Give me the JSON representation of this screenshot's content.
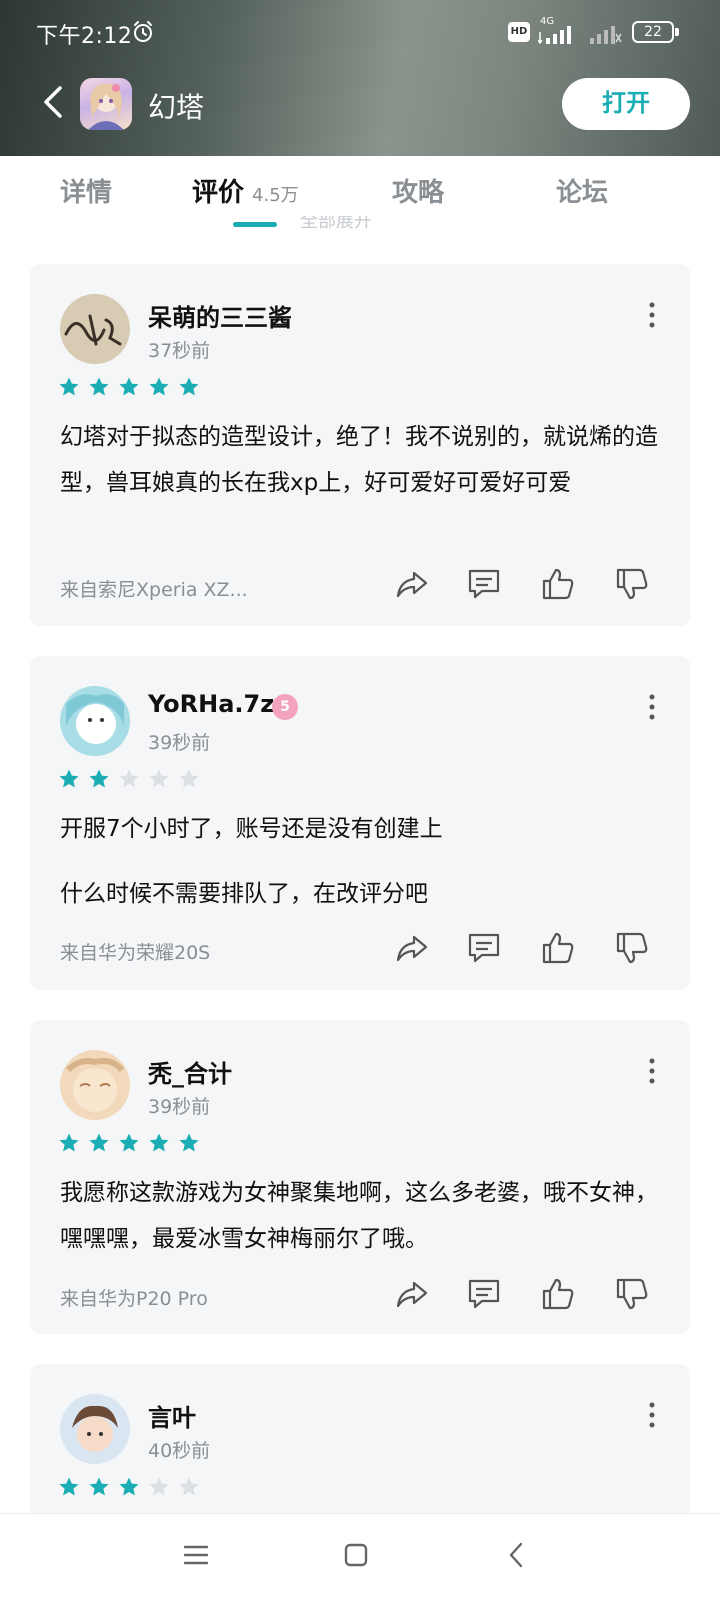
{
  "status": {
    "time": "下午2:12",
    "hd": "HD",
    "network": "4G",
    "battery": "22"
  },
  "header": {
    "app_name": "幻塔",
    "open_label": "打开"
  },
  "tabs": [
    {
      "label": "详情"
    },
    {
      "label": "评价",
      "count": "4.5万"
    },
    {
      "label": "攻略"
    },
    {
      "label": "论坛"
    }
  ],
  "expand_hint": "全部展开",
  "accent_color": "#1aadb3",
  "reviews": [
    {
      "username": "呆萌的三三酱",
      "time": "37秒前",
      "rating": 5,
      "text": [
        "幻塔对于拟态的造型设计，绝了！我不说别的，就说烯的造型，兽耳娘真的长在我xp上，好可爱好可爱好可爱"
      ],
      "device": "来自索尼Xperia XZ..."
    },
    {
      "username": "YoRHa.7z",
      "level": "5",
      "time": "39秒前",
      "rating": 2,
      "text": [
        "开服7个小时了，账号还是没有创建上",
        "什么时候不需要排队了，在改评分吧"
      ],
      "device": "来自华为荣耀20S"
    },
    {
      "username": "秃_合计",
      "time": "39秒前",
      "rating": 5,
      "text": [
        "我愿称这款游戏为女神聚集地啊，这么多老婆，哦不女神，嘿嘿嘿，最爱冰雪女神梅丽尔了哦。"
      ],
      "device": "来自华为P20 Pro"
    },
    {
      "username": "言叶",
      "time": "40秒前",
      "rating": 3
    }
  ],
  "icons": [
    "alarm-icon",
    "signal-icon",
    "back-arrow-icon",
    "more-vertical-icon",
    "share-icon",
    "comment-icon",
    "thumbs-up-icon",
    "thumbs-down-icon",
    "star-icon",
    "menu-icon",
    "home-square-icon",
    "back-triangle-icon"
  ]
}
